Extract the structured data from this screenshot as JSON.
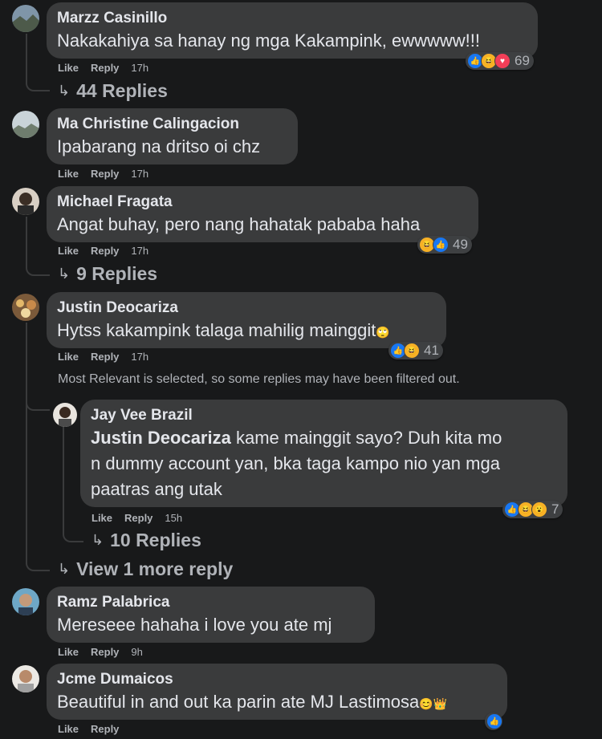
{
  "colors": {
    "bg": "#18191a",
    "bubble": "#3a3b3c",
    "text": "#e4e6eb",
    "muted": "#b0b3b8",
    "like": "#1877f2",
    "haha": "#f7b125",
    "love": "#f33e58"
  },
  "labels": {
    "like": "Like",
    "reply": "Reply"
  },
  "comments": [
    {
      "author": "Marzz Casinillo",
      "text": "Nakakahiya sa hanay ng mga Kakampink, ewwwww!!!",
      "time": "17h",
      "reactions": [
        "like-icon",
        "haha-icon",
        "love-icon"
      ],
      "count": "69",
      "replies": "44 Replies"
    },
    {
      "author": "Ma Christine Calingacion",
      "text": "Ipabarang na dritso oi chz",
      "time": "17h"
    },
    {
      "author": "Michael Fragata",
      "text": "Angat buhay, pero nang hahatak pababa haha",
      "time": "17h",
      "reactions": [
        "haha-icon",
        "like-icon"
      ],
      "count": "49",
      "replies": "9 Replies"
    },
    {
      "author": "Justin Deocariza",
      "text": "Hytss kakampink talaga mahilig mainggit",
      "time": "17h",
      "reactions": [
        "like-icon",
        "haha-icon"
      ],
      "count": "41",
      "filter_note": "Most Relevant is selected, so some replies may have been filtered out.",
      "reply": {
        "author": "Jay Vee Brazil",
        "mention": "Justin Deocariza",
        "text_line1": " kame mainggit sayo? Duh kita mo",
        "text_line2": "n dummy account yan, bka taga kampo nio yan mga",
        "text_line3": "paatras ang utak",
        "time": "15h",
        "reactions": [
          "like-icon",
          "haha-icon",
          "wow-icon"
        ],
        "count": "7",
        "replies": "10 Replies"
      },
      "more": "View 1 more reply"
    },
    {
      "author": "Ramz Palabrica",
      "text": "Mereseee hahaha i love you ate mj",
      "time": "9h"
    },
    {
      "author": "Jcme Dumaicos",
      "text": "Beautiful in and out ka parin ate MJ Lastimosa",
      "time": ""
    }
  ]
}
